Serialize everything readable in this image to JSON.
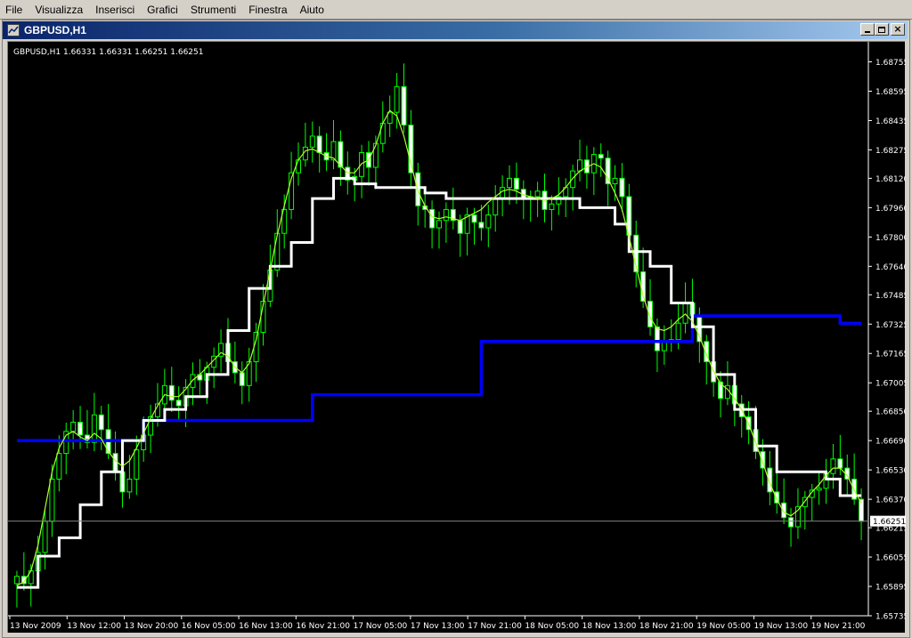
{
  "menu": [
    "File",
    "Visualizza",
    "Inserisci",
    "Grafici",
    "Strumenti",
    "Finestra",
    "Aiuto"
  ],
  "window": {
    "title": "GBPUSD,H1"
  },
  "chart_info": "GBPUSD,H1  1.66331 1.66331 1.66251 1.66251",
  "current_price": "1.66251",
  "colors": {
    "background": "#000000",
    "bull_candle": "#ffffff",
    "bear_candle": "#00ff00",
    "wick": "#00ff00",
    "moving_average": "#adff2f",
    "channel_line": "#ffffff",
    "support_line": "#0000ff",
    "axis_text": "#ffffff",
    "price_line": "#808080"
  },
  "chart_data": {
    "type": "candlestick",
    "symbol": "GBPUSD",
    "timeframe": "H1",
    "y_ticks": [
      "1.68755",
      "1.68595",
      "1.68435",
      "1.68275",
      "1.68120",
      "1.67960",
      "1.67800",
      "1.67640",
      "1.67485",
      "1.67325",
      "1.67165",
      "1.67005",
      "1.66850",
      "1.66690",
      "1.66530",
      "1.66370",
      "1.66215",
      "1.66055",
      "1.65895",
      "1.65735"
    ],
    "x_ticks": [
      "13 Nov 2009",
      "13 Nov 12:00",
      "13 Nov 20:00",
      "16 Nov 05:00",
      "16 Nov 13:00",
      "16 Nov 21:00",
      "17 Nov 05:00",
      "17 Nov 13:00",
      "17 Nov 21:00",
      "18 Nov 05:00",
      "18 Nov 13:00",
      "18 Nov 21:00",
      "19 Nov 05:00",
      "19 Nov 13:00",
      "19 Nov 21:00"
    ],
    "ylim": [
      1.65735,
      1.68835
    ],
    "candle_closes": [
      1.6595,
      1.6591,
      1.6598,
      1.6608,
      1.6625,
      1.6648,
      1.6662,
      1.6674,
      1.6679,
      1.6672,
      1.6668,
      1.6683,
      1.6675,
      1.6662,
      1.6652,
      1.6641,
      1.6648,
      1.6664,
      1.6672,
      1.6682,
      1.6689,
      1.6699,
      1.6691,
      1.6688,
      1.6698,
      1.6705,
      1.6702,
      1.6709,
      1.6715,
      1.6722,
      1.6712,
      1.6706,
      1.6699,
      1.6712,
      1.6728,
      1.6745,
      1.6762,
      1.6782,
      1.6795,
      1.6815,
      1.6822,
      1.6829,
      1.6835,
      1.6826,
      1.6822,
      1.6832,
      1.6818,
      1.6811,
      1.6813,
      1.6826,
      1.6818,
      1.6831,
      1.6842,
      1.6848,
      1.6862,
      1.6841,
      1.6815,
      1.6797,
      1.6795,
      1.6785,
      1.6789,
      1.6795,
      1.6789,
      1.6782,
      1.6792,
      1.6788,
      1.6785,
      1.6792,
      1.6801,
      1.6807,
      1.6812,
      1.6806,
      1.6801,
      1.6802,
      1.6805,
      1.6795,
      1.6798,
      1.6802,
      1.6807,
      1.6816,
      1.6822,
      1.6815,
      1.6825,
      1.6823,
      1.6809,
      1.6812,
      1.6802,
      1.6781,
      1.6761,
      1.6745,
      1.6731,
      1.6718,
      1.6723,
      1.6724,
      1.6733,
      1.6744,
      1.6737,
      1.6723,
      1.6712,
      1.6701,
      1.6692,
      1.6699,
      1.6689,
      1.6682,
      1.6675,
      1.6663,
      1.6654,
      1.6641,
      1.6635,
      1.6627,
      1.6622,
      1.6633,
      1.6638,
      1.6642,
      1.6643,
      1.6651,
      1.6659,
      1.6654,
      1.6648,
      1.6637,
      1.6625
    ],
    "moving_average": [
      1.659,
      1.6592,
      1.6598,
      1.6612,
      1.6632,
      1.6652,
      1.6665,
      1.6672,
      1.6674,
      1.6671,
      1.6669,
      1.6673,
      1.667,
      1.6663,
      1.6658,
      1.6655,
      1.6658,
      1.6665,
      1.6673,
      1.6681,
      1.6688,
      1.6694,
      1.6693,
      1.6693,
      1.6697,
      1.6702,
      1.6705,
      1.6709,
      1.6713,
      1.6717,
      1.6715,
      1.6709,
      1.6706,
      1.6711,
      1.6724,
      1.6743,
      1.6762,
      1.6781,
      1.6797,
      1.6812,
      1.6822,
      1.6827,
      1.6828,
      1.6826,
      1.6824,
      1.6823,
      1.6819,
      1.6815,
      1.6815,
      1.682,
      1.6822,
      1.683,
      1.6842,
      1.6849,
      1.6846,
      1.6835,
      1.682,
      1.6805,
      1.6797,
      1.6791,
      1.679,
      1.6791,
      1.679,
      1.6789,
      1.6791,
      1.6793,
      1.6795,
      1.6799,
      1.6802,
      1.6805,
      1.6806,
      1.6805,
      1.6803,
      1.6802,
      1.6801,
      1.68,
      1.6801,
      1.6803,
      1.6807,
      1.6812,
      1.6816,
      1.6818,
      1.682,
      1.6818,
      1.6812,
      1.6804,
      1.6795,
      1.678,
      1.6764,
      1.6748,
      1.6736,
      1.673,
      1.6729,
      1.6731,
      1.6735,
      1.6738,
      1.6734,
      1.6726,
      1.6716,
      1.6707,
      1.67,
      1.6697,
      1.6692,
      1.6686,
      1.6678,
      1.6668,
      1.6657,
      1.6646,
      1.6637,
      1.663,
      1.6628,
      1.6631,
      1.6636,
      1.6641,
      1.6645,
      1.665,
      1.6654,
      1.6654,
      1.665,
      1.6642,
      1.6635
    ],
    "channel_line": [
      1.6589,
      1.6589,
      1.6589,
      1.6606,
      1.6606,
      1.6606,
      1.6616,
      1.6616,
      1.6616,
      1.6634,
      1.6634,
      1.6634,
      1.6652,
      1.6652,
      1.6652,
      1.6669,
      1.6669,
      1.6669,
      1.668,
      1.668,
      1.668,
      1.6686,
      1.6686,
      1.6686,
      1.6693,
      1.6693,
      1.6693,
      1.6705,
      1.6705,
      1.6705,
      1.6729,
      1.6729,
      1.6729,
      1.6752,
      1.6752,
      1.6752,
      1.6764,
      1.6764,
      1.6764,
      1.6777,
      1.6777,
      1.6777,
      1.6801,
      1.6801,
      1.6801,
      1.6812,
      1.6812,
      1.6812,
      1.6809,
      1.6809,
      1.6809,
      1.6807,
      1.6807,
      1.6807,
      1.6807,
      1.6807,
      1.6807,
      1.6807,
      1.6804,
      1.6804,
      1.6804,
      1.6801,
      1.6801,
      1.6801,
      1.6801,
      1.6801,
      1.6801,
      1.6801,
      1.6801,
      1.6801,
      1.6801,
      1.6801,
      1.6801,
      1.6801,
      1.6801,
      1.6801,
      1.6801,
      1.6801,
      1.6801,
      1.6801,
      1.6796,
      1.6796,
      1.6796,
      1.6796,
      1.6796,
      1.6787,
      1.6787,
      1.6772,
      1.6772,
      1.6772,
      1.6764,
      1.6764,
      1.6764,
      1.6744,
      1.6744,
      1.6744,
      1.6731,
      1.6731,
      1.6731,
      1.6705,
      1.6705,
      1.6705,
      1.6686,
      1.6686,
      1.6686,
      1.6666,
      1.6666,
      1.6666,
      1.6652,
      1.6652,
      1.6652,
      1.6652,
      1.6652,
      1.6652,
      1.6652,
      1.6648,
      1.6648,
      1.6639,
      1.6639,
      1.6639,
      1.6639
    ],
    "support_line": [
      1.6669,
      1.6669,
      1.6669,
      1.6669,
      1.6669,
      1.6669,
      1.6669,
      1.6669,
      1.6669,
      1.6669,
      1.6669,
      1.6669,
      1.6669,
      1.6669,
      1.6669,
      1.6669,
      1.6669,
      1.6669,
      1.668,
      1.668,
      1.668,
      1.668,
      1.668,
      1.668,
      1.668,
      1.668,
      1.668,
      1.668,
      1.668,
      1.668,
      1.668,
      1.668,
      1.668,
      1.668,
      1.668,
      1.668,
      1.668,
      1.668,
      1.668,
      1.668,
      1.668,
      1.668,
      1.6694,
      1.6694,
      1.6694,
      1.6694,
      1.6694,
      1.6694,
      1.6694,
      1.6694,
      1.6694,
      1.6694,
      1.6694,
      1.6694,
      1.6694,
      1.6694,
      1.6694,
      1.6694,
      1.6694,
      1.6694,
      1.6694,
      1.6694,
      1.6694,
      1.6694,
      1.6694,
      1.6694,
      1.6723,
      1.6723,
      1.6723,
      1.6723,
      1.6723,
      1.6723,
      1.6723,
      1.6723,
      1.6723,
      1.6723,
      1.6723,
      1.6723,
      1.6723,
      1.6723,
      1.6723,
      1.6723,
      1.6723,
      1.6723,
      1.6723,
      1.6723,
      1.6723,
      1.6723,
      1.6723,
      1.6723,
      1.6723,
      1.6723,
      1.6723,
      1.6723,
      1.6723,
      1.6723,
      1.6737,
      1.6737,
      1.6737,
      1.6737,
      1.6737,
      1.6737,
      1.6737,
      1.6737,
      1.6737,
      1.6737,
      1.6737,
      1.6737,
      1.6737,
      1.6737,
      1.6737,
      1.6737,
      1.6737,
      1.6737,
      1.6737,
      1.6737,
      1.6737,
      1.6733,
      1.6733,
      1.6733,
      1.6733
    ]
  }
}
